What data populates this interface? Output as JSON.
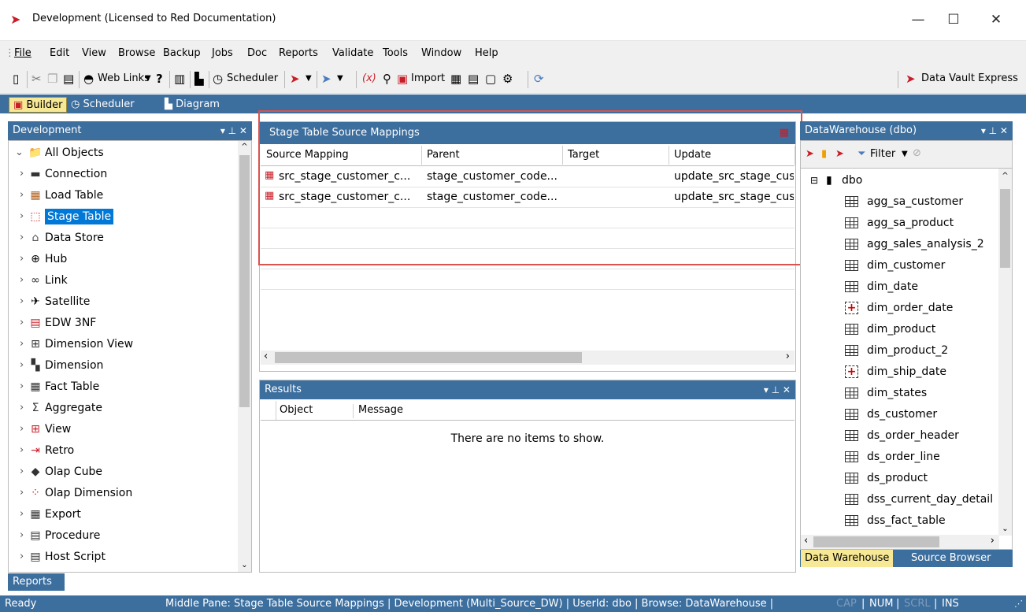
{
  "window": {
    "title": "Development  (Licensed to Red Documentation)",
    "minimize": "—",
    "maximize": "☐",
    "close": "✕"
  },
  "menu": [
    "File",
    "Edit",
    "View",
    "Browse",
    "Backup",
    "Jobs",
    "Doc",
    "Reports",
    "Validate",
    "Tools",
    "Window",
    "Help"
  ],
  "toolbar": {
    "web_links": "Web Links",
    "scheduler": "Scheduler",
    "import": "Import",
    "dve": "Data Vault Express"
  },
  "view_tabs": {
    "builder": "Builder",
    "scheduler": "Scheduler",
    "diagram": "Diagram"
  },
  "left_pane": {
    "title": "Development",
    "controls": "▾ ⊥ ✕",
    "root": "All Objects",
    "items": [
      "Connection",
      "Load Table",
      "Stage Table",
      "Data Store",
      "Hub",
      "Link",
      "Satellite",
      "EDW 3NF",
      "Dimension View",
      "Dimension",
      "Fact Table",
      "Aggregate",
      "View",
      "Retro",
      "Olap Cube",
      "Olap Dimension",
      "Export",
      "Procedure",
      "Host Script"
    ],
    "selected": "Stage Table"
  },
  "middle": {
    "title": "Stage Table Source Mappings",
    "columns": [
      "Source Mapping",
      "Parent",
      "Target",
      "Update"
    ],
    "rows": [
      [
        "src_stage_customer_c...",
        "stage_customer_code...",
        "",
        "update_src_stage_cus"
      ],
      [
        "src_stage_customer_c...",
        "stage_customer_code...",
        "",
        "update_src_stage_cus"
      ]
    ]
  },
  "results": {
    "title": "Results",
    "controls": "▾ ⊥ ✕",
    "columns": [
      "Object",
      "Message"
    ],
    "empty": "There are no items to show."
  },
  "right_pane": {
    "title": "DataWarehouse (dbo)",
    "controls": "▾ ⊥ ✕",
    "filter": "Filter",
    "schema": "dbo",
    "items": [
      {
        "name": "agg_sa_customer",
        "kind": "table"
      },
      {
        "name": "agg_sa_product",
        "kind": "table"
      },
      {
        "name": "agg_sales_analysis_2",
        "kind": "table"
      },
      {
        "name": "dim_customer",
        "kind": "table"
      },
      {
        "name": "dim_date",
        "kind": "table"
      },
      {
        "name": "dim_order_date",
        "kind": "view"
      },
      {
        "name": "dim_product",
        "kind": "table"
      },
      {
        "name": "dim_product_2",
        "kind": "table"
      },
      {
        "name": "dim_ship_date",
        "kind": "view"
      },
      {
        "name": "dim_states",
        "kind": "table"
      },
      {
        "name": "ds_customer",
        "kind": "table"
      },
      {
        "name": "ds_order_header",
        "kind": "table"
      },
      {
        "name": "ds_order_line",
        "kind": "table"
      },
      {
        "name": "ds_product",
        "kind": "table"
      },
      {
        "name": "dss_current_day_detail",
        "kind": "table"
      },
      {
        "name": "dss_fact_table",
        "kind": "table"
      }
    ],
    "tabs": [
      "Data Warehouse",
      "Source Browser"
    ]
  },
  "bottom": {
    "reports_tab": "Reports"
  },
  "status": {
    "ready": "Ready",
    "info": "Middle Pane: Stage Table Source Mappings | Development (Multi_Source_DW) | UserId: dbo | Browse: DataWarehouse |",
    "cap": "CAP",
    "num": "NUM",
    "scrl": "SCRL",
    "ins": "INS"
  }
}
